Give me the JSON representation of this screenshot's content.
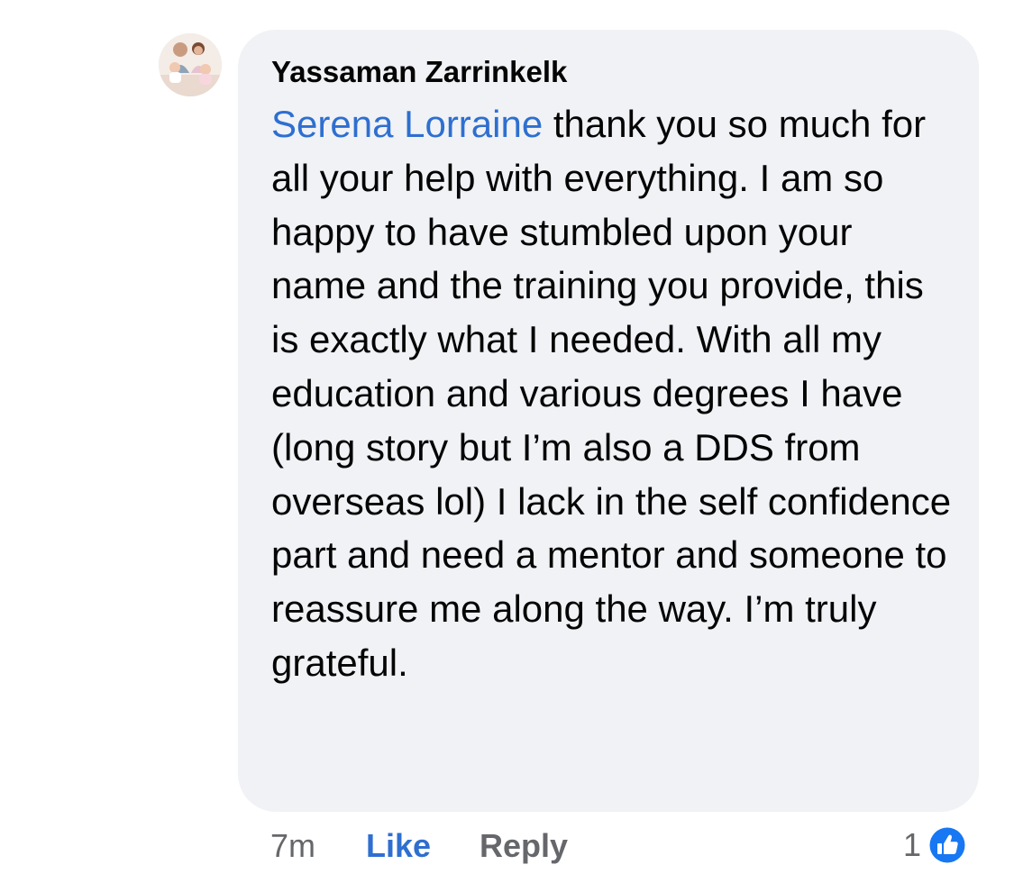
{
  "comment": {
    "author": "Yassaman Zarrinkelk",
    "mention": "Serena Lorraine",
    "text": " thank you so much for all your help with everything. I am so happy to have stumbled upon your name and the training you provide, this is exactly what I needed. With all my education and various degrees I have (long story but I’m also a DDS from overseas lol) I lack in the self confidence part and need a mentor and someone to reassure me along the way. I’m truly grateful."
  },
  "actions": {
    "time": "7m",
    "like_label": "Like",
    "reply_label": "Reply"
  },
  "reactions": {
    "count": "1",
    "icon": "thumbs-up-icon"
  },
  "colors": {
    "bubble_bg": "#f0f2f5",
    "accent_blue": "#2e6fd0",
    "muted_text": "#65676b",
    "body_text": "#050505"
  }
}
